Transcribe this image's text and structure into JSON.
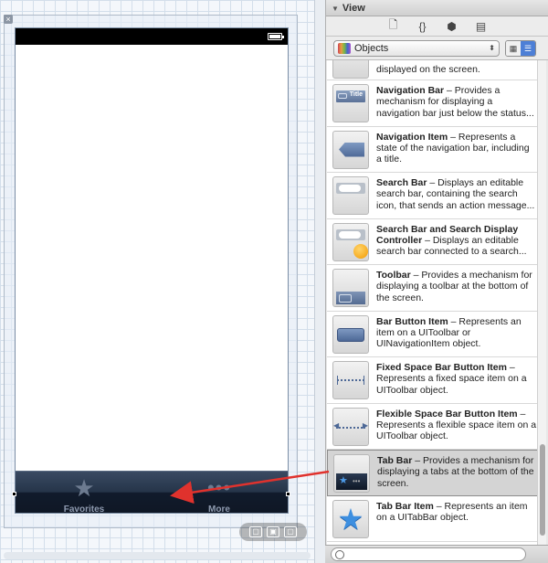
{
  "canvas": {
    "close_label": "×",
    "tab_bar": {
      "items": [
        {
          "label": "Favorites",
          "glyph": "★",
          "icon": "star-icon"
        },
        {
          "label": "More",
          "glyph": "•••",
          "icon": "more-dots-icon"
        }
      ]
    },
    "zoom_controls": [
      "▢",
      "▣",
      "▢"
    ]
  },
  "panel": {
    "title": "View",
    "toolbar_icons": [
      {
        "glyph": "🗋",
        "icon": "file-template-icon"
      },
      {
        "glyph": "{}",
        "icon": "code-snippet-icon"
      },
      {
        "glyph": "⬢",
        "icon": "object-cube-icon"
      },
      {
        "glyph": "▤",
        "icon": "media-icon"
      }
    ],
    "library_selector": {
      "value": "Objects"
    },
    "view_modes": [
      "▦",
      "☰"
    ],
    "items": [
      {
        "name": "",
        "desc": "displayed on the screen.",
        "thumb": "blank"
      },
      {
        "name": "Navigation Bar",
        "desc": " – Provides a mechanism for displaying a navigation bar just below the status...",
        "thumb": "navbar",
        "thumb_text": "Title"
      },
      {
        "name": "Navigation Item",
        "desc": " – Represents a state of the navigation bar, including a title.",
        "thumb": "navitem"
      },
      {
        "name": "Search Bar",
        "desc": " – Displays an editable search bar, containing the search icon, that sends an action message...",
        "thumb": "search"
      },
      {
        "name": "Search Bar and Search Display Controller",
        "desc": " – Displays an editable search bar connected to a search...",
        "thumb": "searchdisplay"
      },
      {
        "name": "Toolbar",
        "desc": " – Provides a mechanism for displaying a toolbar at the bottom of the screen.",
        "thumb": "toolbar"
      },
      {
        "name": "Bar Button Item",
        "desc": " – Represents an item on a UIToolbar or UINavigationItem object.",
        "thumb": "barbutton"
      },
      {
        "name": "Fixed Space Bar Button Item",
        "desc": " – Represents a fixed space item on a UIToolbar object.",
        "thumb": "fixed"
      },
      {
        "name": "Flexible Space Bar Button Item",
        "desc": " – Represents a flexible space item on a UIToolbar object.",
        "thumb": "flexible"
      },
      {
        "name": "Tab Bar",
        "desc": " – Provides a mechanism for displaying a tabs at the bottom of the screen.",
        "thumb": "tabbar",
        "selected": true
      },
      {
        "name": "Tab Bar Item",
        "desc": " – Represents an item on a UITabBar object.",
        "thumb": "tabitem"
      }
    ]
  },
  "colors": {
    "arrow": "#e0322d",
    "selection": "#d4d4d4",
    "accent": "#4d7fd6"
  }
}
